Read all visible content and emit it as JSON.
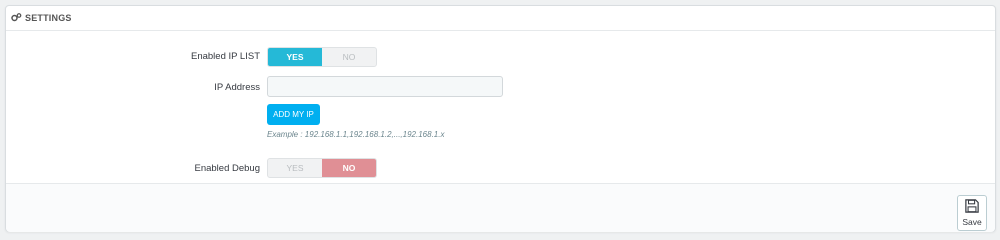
{
  "panel": {
    "title": "SETTINGS",
    "icon": "cogs-icon"
  },
  "form": {
    "enabled_ip_list": {
      "label": "Enabled IP LIST",
      "yes_label": "YES",
      "no_label": "NO",
      "selected": "YES"
    },
    "ip_address": {
      "label": "IP Address",
      "value": "",
      "placeholder": ""
    },
    "add_my_ip_label": "ADD MY IP",
    "help_text": "Example : 192.168.1.1,192.168.1.2,...,192.168.1.x",
    "enabled_debug": {
      "label": "Enabled Debug",
      "yes_label": "YES",
      "no_label": "NO",
      "selected": "NO"
    }
  },
  "footer": {
    "save_label": "Save",
    "save_icon": "floppy-disk-icon"
  },
  "colors": {
    "accent": "#25b9d7",
    "no_active": "#e08f95",
    "button": "#00aff0"
  }
}
